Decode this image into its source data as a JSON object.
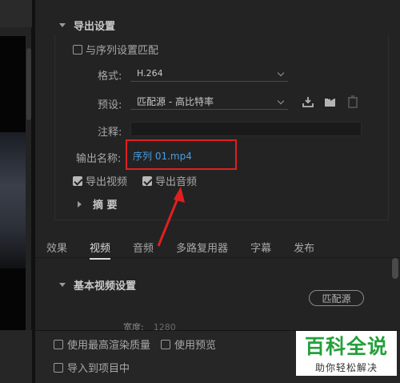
{
  "export_settings": {
    "section_title": "导出设置",
    "match_sequence_label": "与序列设置匹配",
    "match_sequence_checked": false,
    "format_label": "格式:",
    "format_value": "H.264",
    "preset_label": "预设:",
    "preset_value": "匹配源 - 高比特率",
    "comments_label": "注释:",
    "comments_value": "",
    "output_name_label": "输出名称:",
    "output_name_value": "序列 01.mp4",
    "export_video_label": "导出视频",
    "export_video_checked": true,
    "export_audio_label": "导出音频",
    "export_audio_checked": true,
    "summary_label": "摘  要"
  },
  "tabs": [
    {
      "label": "效果",
      "active": false
    },
    {
      "label": "视频",
      "active": true
    },
    {
      "label": "音频",
      "active": false
    },
    {
      "label": "多路复用器",
      "active": false
    },
    {
      "label": "字幕",
      "active": false
    },
    {
      "label": "发布",
      "active": false
    }
  ],
  "video_section": {
    "title": "基本视频设置",
    "match_source_button": "匹配源",
    "width_label": "宽度:",
    "width_value": "1280"
  },
  "bottom_options": {
    "max_render_quality_label": "使用最高渲染质量",
    "use_previews_label": "使用预览",
    "import_into_project_label": "导入到项目中"
  },
  "watermark": {
    "title": "百科全说",
    "subtitle": "助你轻松解决"
  },
  "colors": {
    "panel_bg": "#232323",
    "link_blue": "#4a9de0",
    "highlight_red": "#e02020",
    "watermark_green": "#24a03a"
  },
  "icons": [
    "save-preset-icon",
    "import-preset-icon",
    "delete-preset-icon",
    "chevron-down-icon"
  ]
}
